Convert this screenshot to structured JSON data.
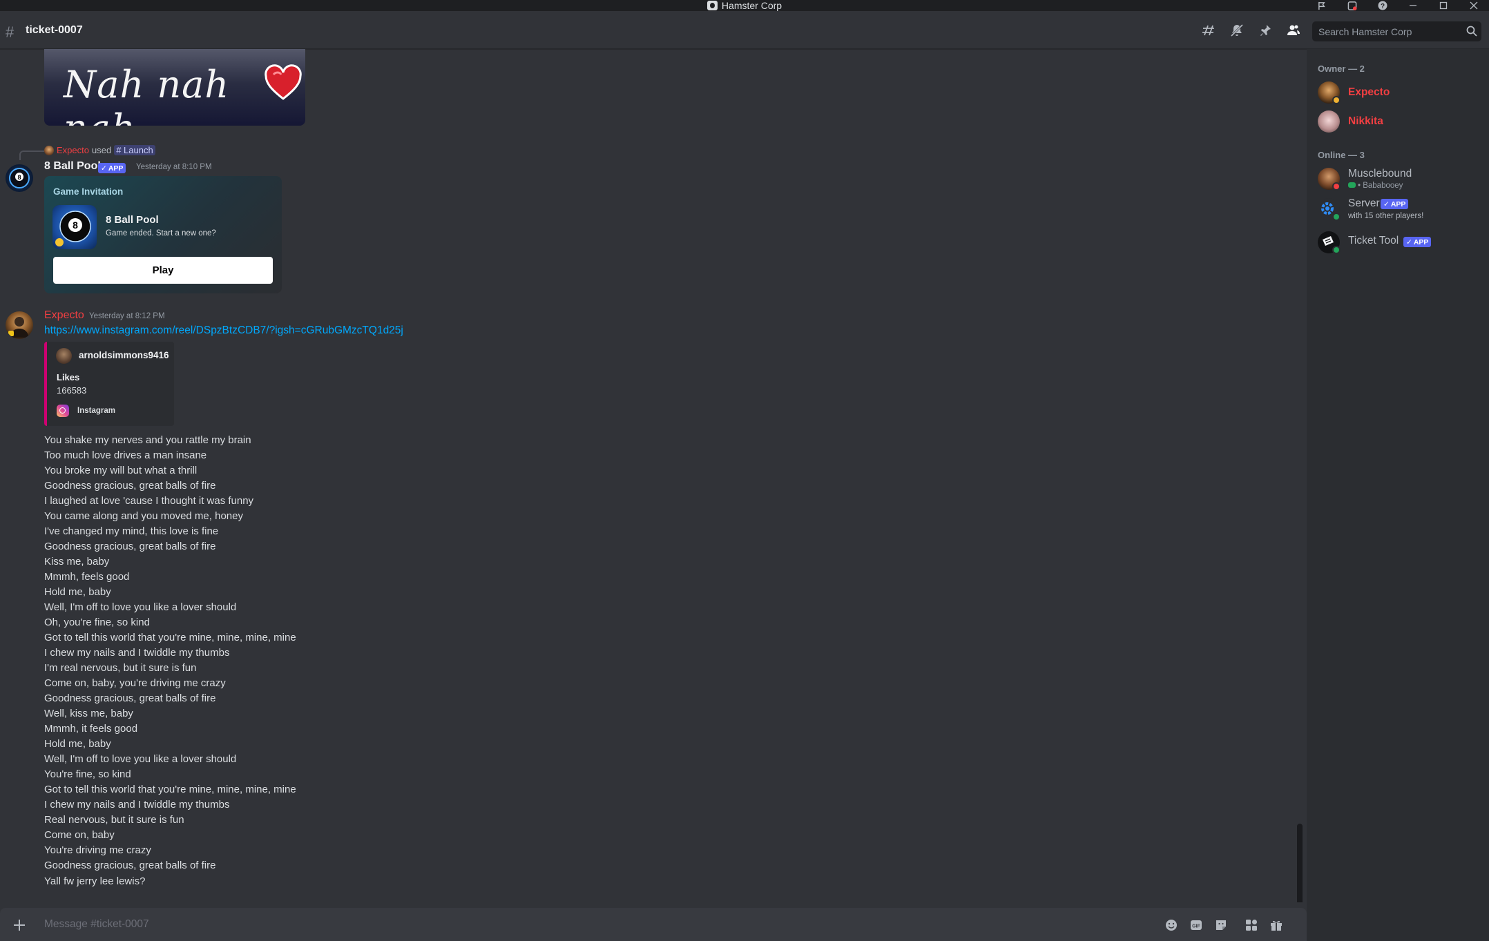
{
  "window": {
    "title": "Hamster Corp"
  },
  "channel": {
    "name": "ticket-0007"
  },
  "search": {
    "placeholder": "Search Hamster Corp"
  },
  "colors": {
    "accent": "#5865f2",
    "owner_red": "#f23f42",
    "link": "#00a8fc",
    "embed_bar": "#ce0071",
    "online": "#23a55a"
  },
  "messages": {
    "image_caption_text": "Nah nah nah",
    "reply": {
      "user": "Expecto",
      "used": "used",
      "command": "Launch"
    },
    "app_message": {
      "author": "8 Ball Pool",
      "badge": "APP",
      "timestamp": "Yesterday at 8:10 PM",
      "card": {
        "header": "Game Invitation",
        "game_name": "8 Ball Pool",
        "subtitle": "Game ended. Start a new one?",
        "button": "Play",
        "icon_glyph": "8"
      }
    },
    "user_message": {
      "author": "Expecto",
      "timestamp": "Yesterday at 8:12 PM",
      "link": "https://www.instagram.com/reel/DSpzBtzCDB7/?igsh=cGRubGMzcTQ1d25j",
      "embed": {
        "author": "arnoldsimmons9416",
        "field_name": "Likes",
        "field_value": "166583",
        "footer": "Instagram"
      },
      "lyrics": [
        "You shake my nerves and you rattle my brain",
        "Too much love drives a man insane",
        "You broke my will but what a thrill",
        "Goodness gracious, great balls of fire",
        "I laughed at love 'cause I thought it was funny",
        "You came along and you moved me, honey",
        "I've changed my mind, this love is fine",
        "Goodness gracious, great balls of fire",
        "Kiss me, baby",
        "Mmmh, feels good",
        "Hold me, baby",
        "Well, I'm off to love you like a lover should",
        "Oh, you're fine, so kind",
        "Got to tell this world that you're mine, mine, mine, mine",
        "I chew my nails and I twiddle my thumbs",
        "I'm real nervous, but it sure is fun",
        "Come on, baby, you're driving me crazy",
        "Goodness gracious, great balls of fire",
        "Well, kiss me, baby",
        "Mmmh, it feels good",
        "Hold me, baby",
        "Well, I'm off to love you like a lover should",
        "You're fine, so kind",
        "Got to tell this world that you're mine, mine, mine, mine",
        "I chew my nails and I twiddle my thumbs",
        "Real nervous, but it sure is fun",
        "Come on, baby",
        "You're driving me crazy",
        "Goodness gracious, great balls of fire"
      ]
    },
    "followup": "Yall fw jerry lee lewis?"
  },
  "composer": {
    "placeholder": "Message #ticket-0007"
  },
  "members": {
    "owner_header": "Owner — 2",
    "owners": [
      {
        "name": "Expecto"
      },
      {
        "name": "Nikkita"
      }
    ],
    "online_header": "Online — 3",
    "online": [
      {
        "name": "Musclebound",
        "activity": "• Bababooey"
      },
      {
        "name": "Server",
        "badge": "APP",
        "activity": "with 15 other players!"
      },
      {
        "name": "Ticket Tool",
        "badge": "APP"
      }
    ]
  }
}
